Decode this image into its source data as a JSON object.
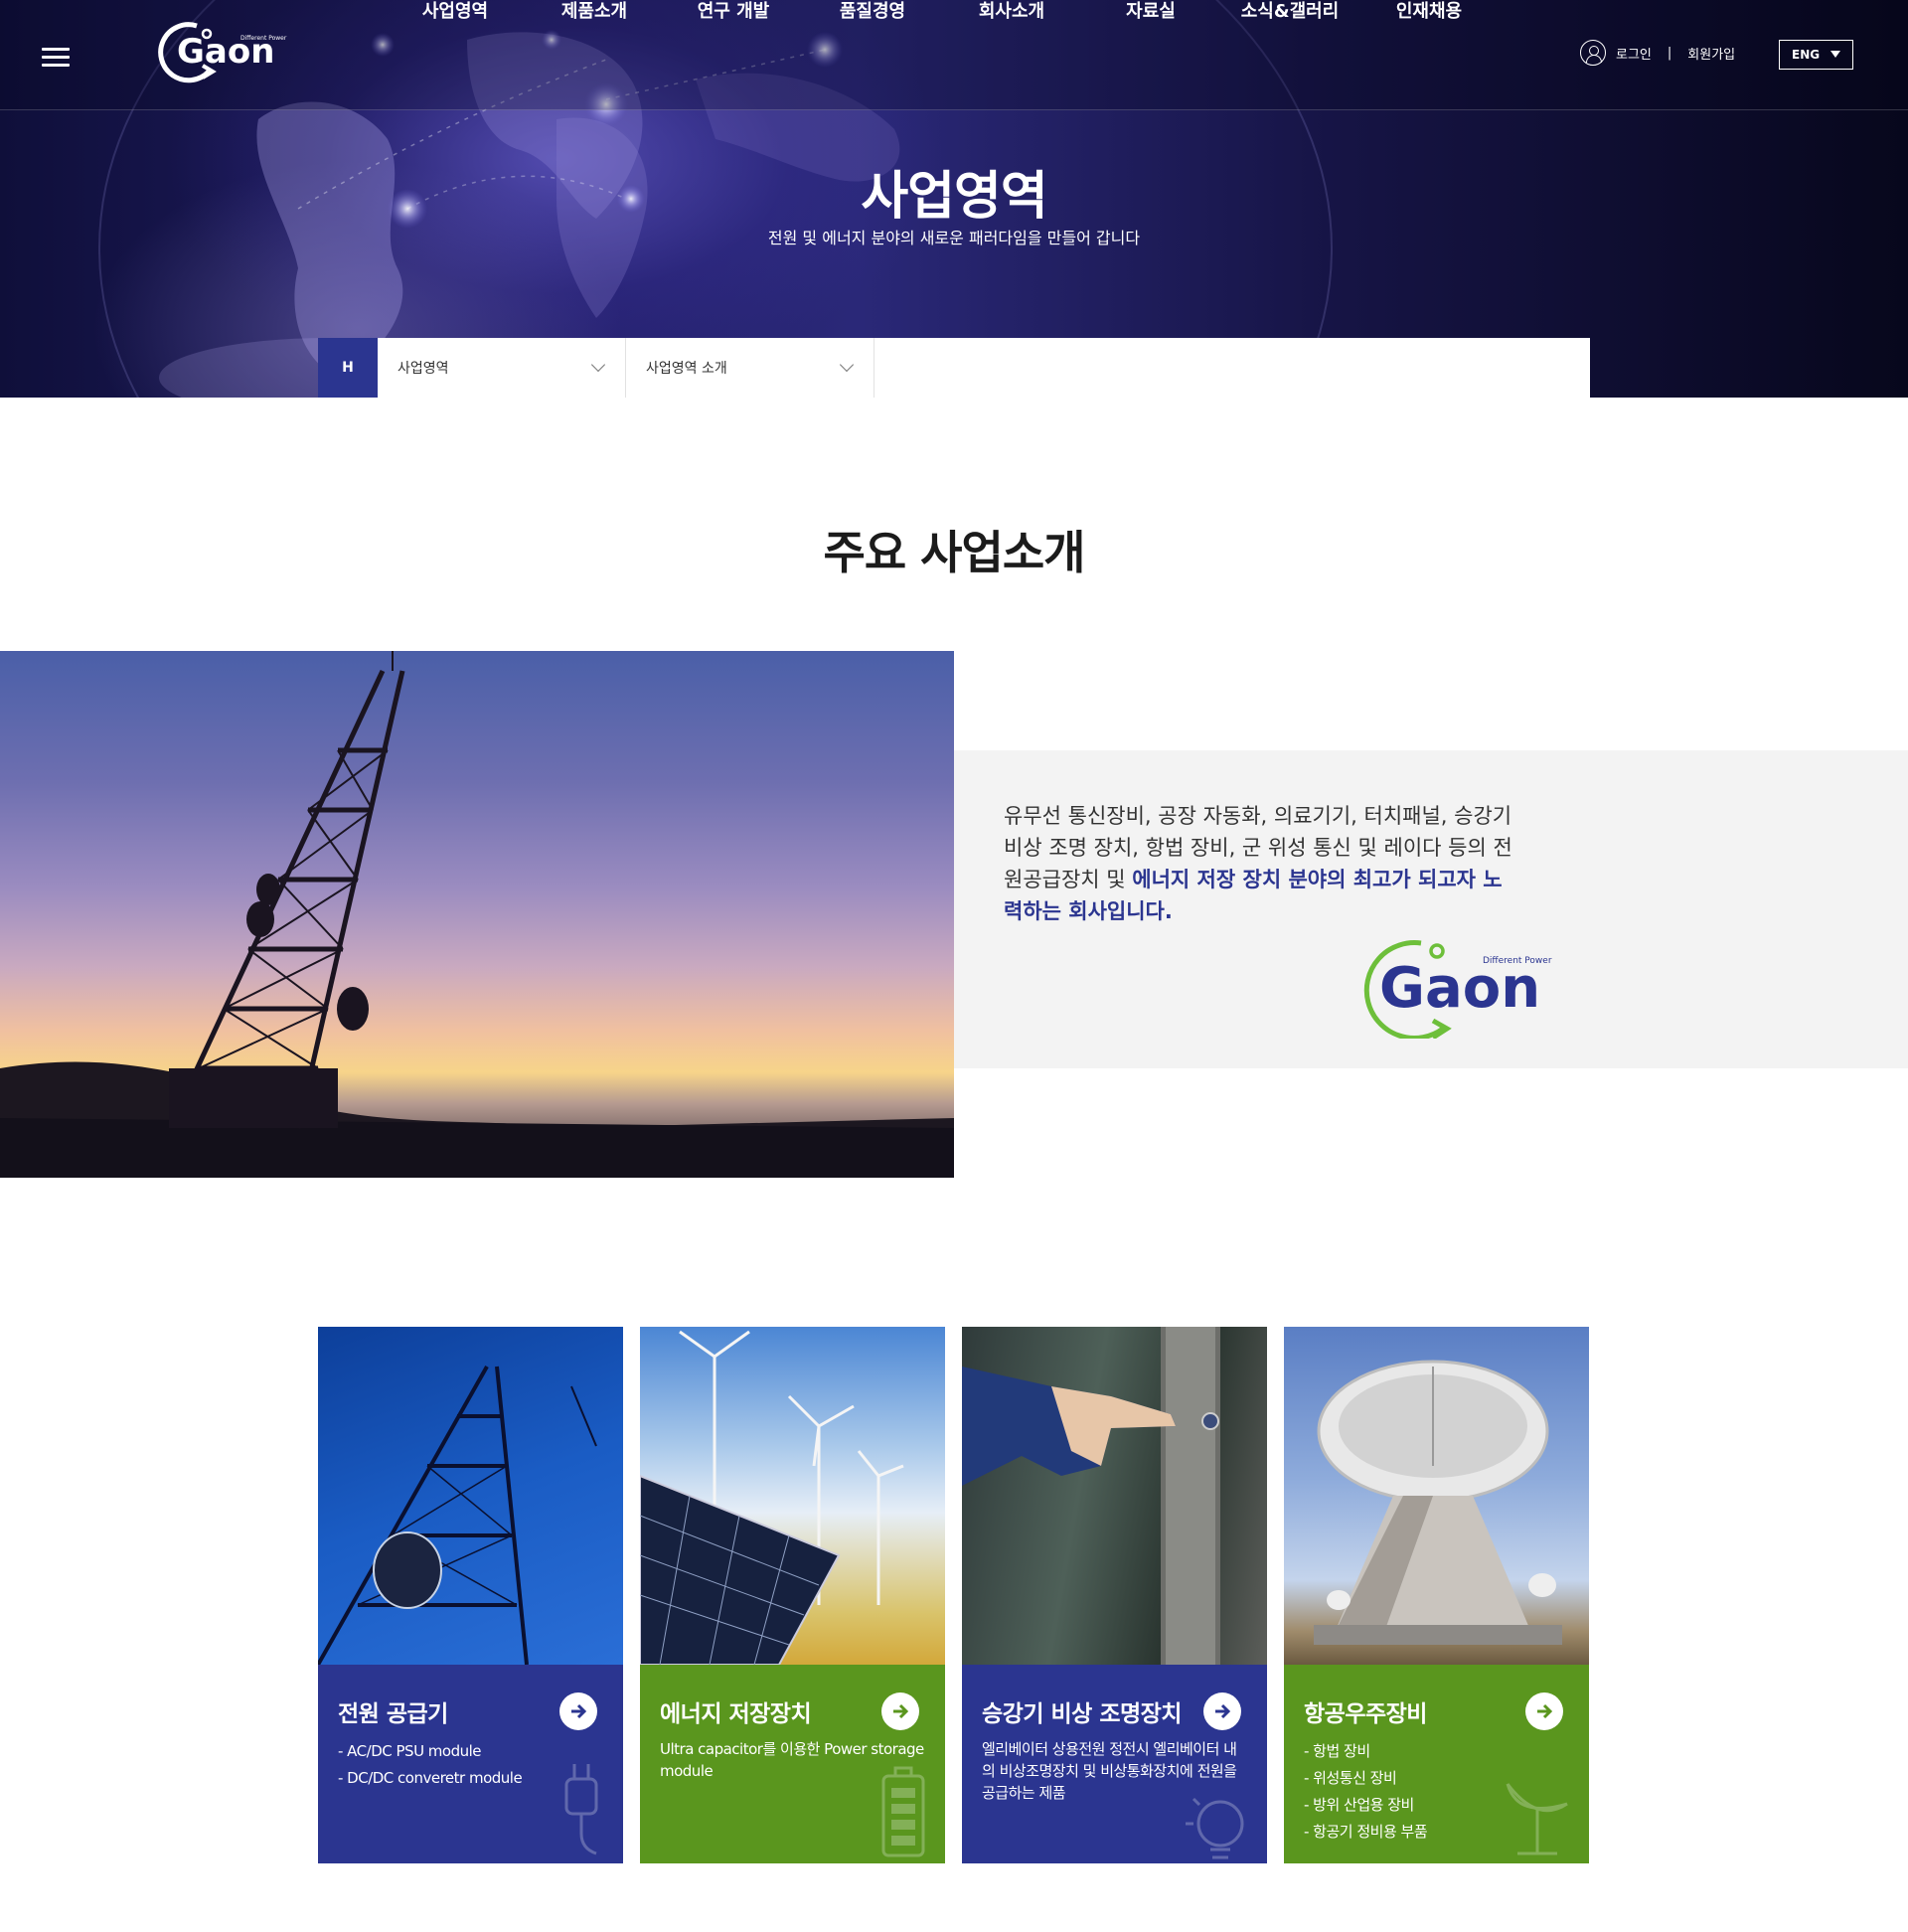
{
  "header": {
    "logo_text": "Gaon",
    "logo_tagline": "Different Power",
    "nav": [
      "사업영역",
      "제품소개",
      "연구 개발",
      "품질경영",
      "회사소개",
      "자료실",
      "소식&갤러리",
      "인재채용"
    ],
    "login": "로그인",
    "separator": "|",
    "signup": "회원가입",
    "lang": "ENG"
  },
  "hero": {
    "title": "사업영역",
    "subtitle": "전원 및 에너지 분야의 새로운 패러다임을 만들어 갑니다"
  },
  "breadcrumb": {
    "home": "H",
    "level1": "사업영역",
    "level2": "사업영역 소개"
  },
  "section": {
    "title": "주요 사업소개"
  },
  "intro": {
    "text_plain": "유무선 통신장비, 공장 자동화, 의료기기, 터치패널, 승강기 비상 조명 장치, 항법 장비, 군 위성 통신 및 레이다 등의 전원공급장치 및 ",
    "text_highlight": "에너지 저장 장치 분야의 최고가 되고자 노력하는 회사입니다.",
    "logo_text": "Gaon",
    "logo_tagline": "Different Power"
  },
  "cards": [
    {
      "title": "전원 공급기",
      "lines": [
        "- AC/DC PSU module",
        "- DC/DC converetr module"
      ],
      "theme": "blue",
      "icon": "plug-icon"
    },
    {
      "title": "에너지 저장장치",
      "lines": [
        "Ultra capacitor를 이용한 Power storage module"
      ],
      "theme": "green",
      "icon": "battery-icon"
    },
    {
      "title": "승강기 비상 조명장치",
      "lines": [
        "엘리베이터 상용전원 정전시 엘리베이터 내의 비상조명장치 및 비상통화장치에 전원을 공급하는 제품"
      ],
      "theme": "blue",
      "icon": "bulb-icon"
    },
    {
      "title": "항공우주장비",
      "lines": [
        "- 항법 장비",
        "- 위성통신 장비",
        "- 방위 산업용 장비",
        "- 항공기 정비용 부품"
      ],
      "theme": "green",
      "icon": "satellite-icon"
    }
  ],
  "colors": {
    "primary_blue": "#2b3590",
    "primary_green": "#5a961e",
    "logo_green": "#6dbf3a"
  }
}
